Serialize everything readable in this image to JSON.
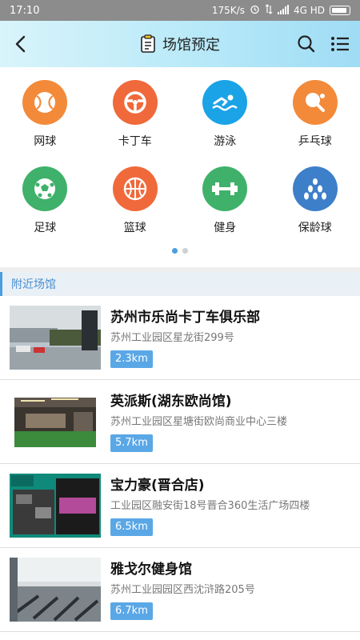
{
  "status_bar": {
    "time": "17:10",
    "speed": "175K/s",
    "network": "4G HD"
  },
  "header": {
    "title": "场馆预定",
    "back_icon": "chevron-left-icon",
    "search_icon": "search-icon",
    "menu_icon": "list-menu-icon"
  },
  "categories": [
    {
      "label": "网球",
      "icon": "tennis-ball-icon",
      "color": "#f28a3a"
    },
    {
      "label": "卡丁车",
      "icon": "steering-wheel-icon",
      "color": "#f0693a"
    },
    {
      "label": "游泳",
      "icon": "swimmer-icon",
      "color": "#1aa3e6"
    },
    {
      "label": "乒乓球",
      "icon": "table-tennis-icon",
      "color": "#f28a3a"
    },
    {
      "label": "足球",
      "icon": "soccer-ball-icon",
      "color": "#3fb16a"
    },
    {
      "label": "篮球",
      "icon": "basketball-icon",
      "color": "#f0693a"
    },
    {
      "label": "健身",
      "icon": "dumbbell-icon",
      "color": "#3fb16a"
    },
    {
      "label": "保龄球",
      "icon": "bowling-icon",
      "color": "#3d7fc9"
    }
  ],
  "pager": {
    "total": 2,
    "active": 1
  },
  "nearby": {
    "title": "附近场馆",
    "venues": [
      {
        "name": "苏州市乐尚卡丁车俱乐部",
        "address": "苏州工业园区星龙街299号",
        "distance": "2.3km"
      },
      {
        "name": "英派斯(湖东欧尚馆)",
        "address": "苏州工业园区星塘街欧尚商业中心三楼",
        "distance": "5.7km"
      },
      {
        "name": "宝力豪(晋合店)",
        "address": "工业园区融安街18号晋合360生活广场四楼",
        "distance": "6.5km"
      },
      {
        "name": "雅戈尔健身馆",
        "address": "苏州工业园园区西沈浒路205号",
        "distance": "6.7km"
      }
    ]
  }
}
